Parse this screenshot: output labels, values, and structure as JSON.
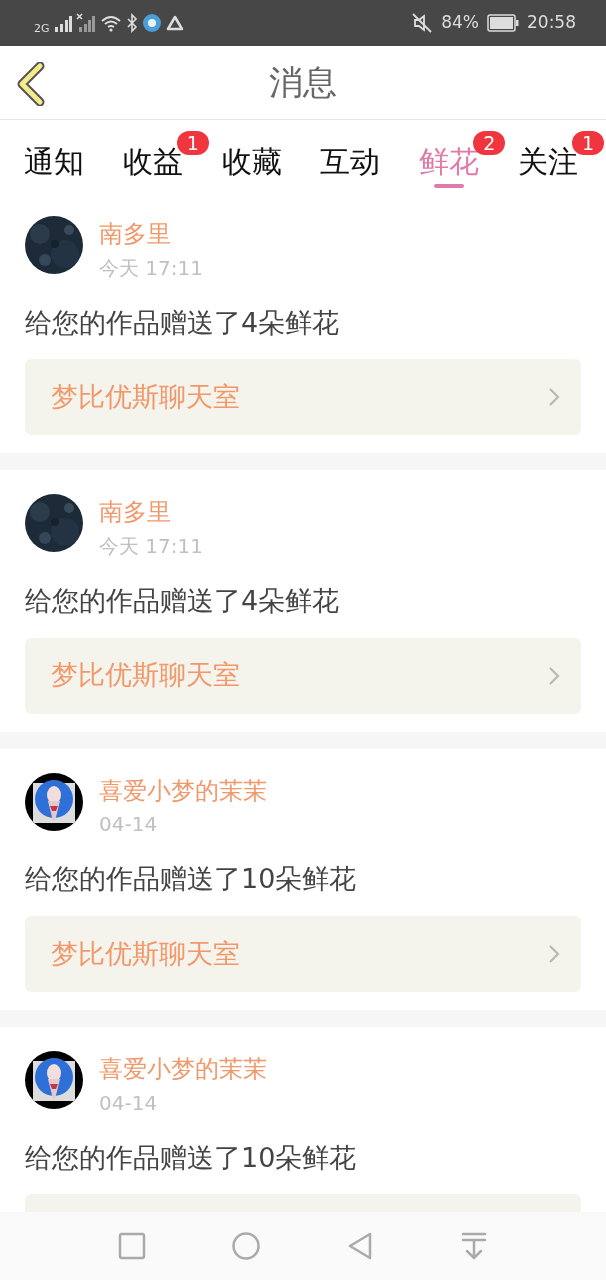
{
  "status_bar": {
    "network": "2G",
    "battery": "84%",
    "time": "20:58"
  },
  "header": {
    "title": "消息"
  },
  "tabs": [
    {
      "label": "通知",
      "selected": false
    },
    {
      "label": "收益",
      "selected": false,
      "badge": "1"
    },
    {
      "label": "收藏",
      "selected": false
    },
    {
      "label": "互动",
      "selected": false
    },
    {
      "label": "鲜花",
      "selected": true,
      "badge": "2"
    },
    {
      "label": "关注",
      "selected": false,
      "badge": "1"
    }
  ],
  "messages": [
    {
      "user": "南多里",
      "time": "今天 17:11",
      "text": "给您的作品赠送了4朵鲜花",
      "link": "梦比优斯聊天室"
    },
    {
      "user": "南多里",
      "time": "今天 17:11",
      "text": "给您的作品赠送了4朵鲜花",
      "link": "梦比优斯聊天室"
    },
    {
      "user": "喜爱小梦的茉茉",
      "time": "04-14",
      "text": "给您的作品赠送了10朵鲜花",
      "link": "梦比优斯聊天室"
    },
    {
      "user": "喜爱小梦的茉茉",
      "time": "04-14",
      "text": "给您的作品赠送了10朵鲜花"
    }
  ]
}
